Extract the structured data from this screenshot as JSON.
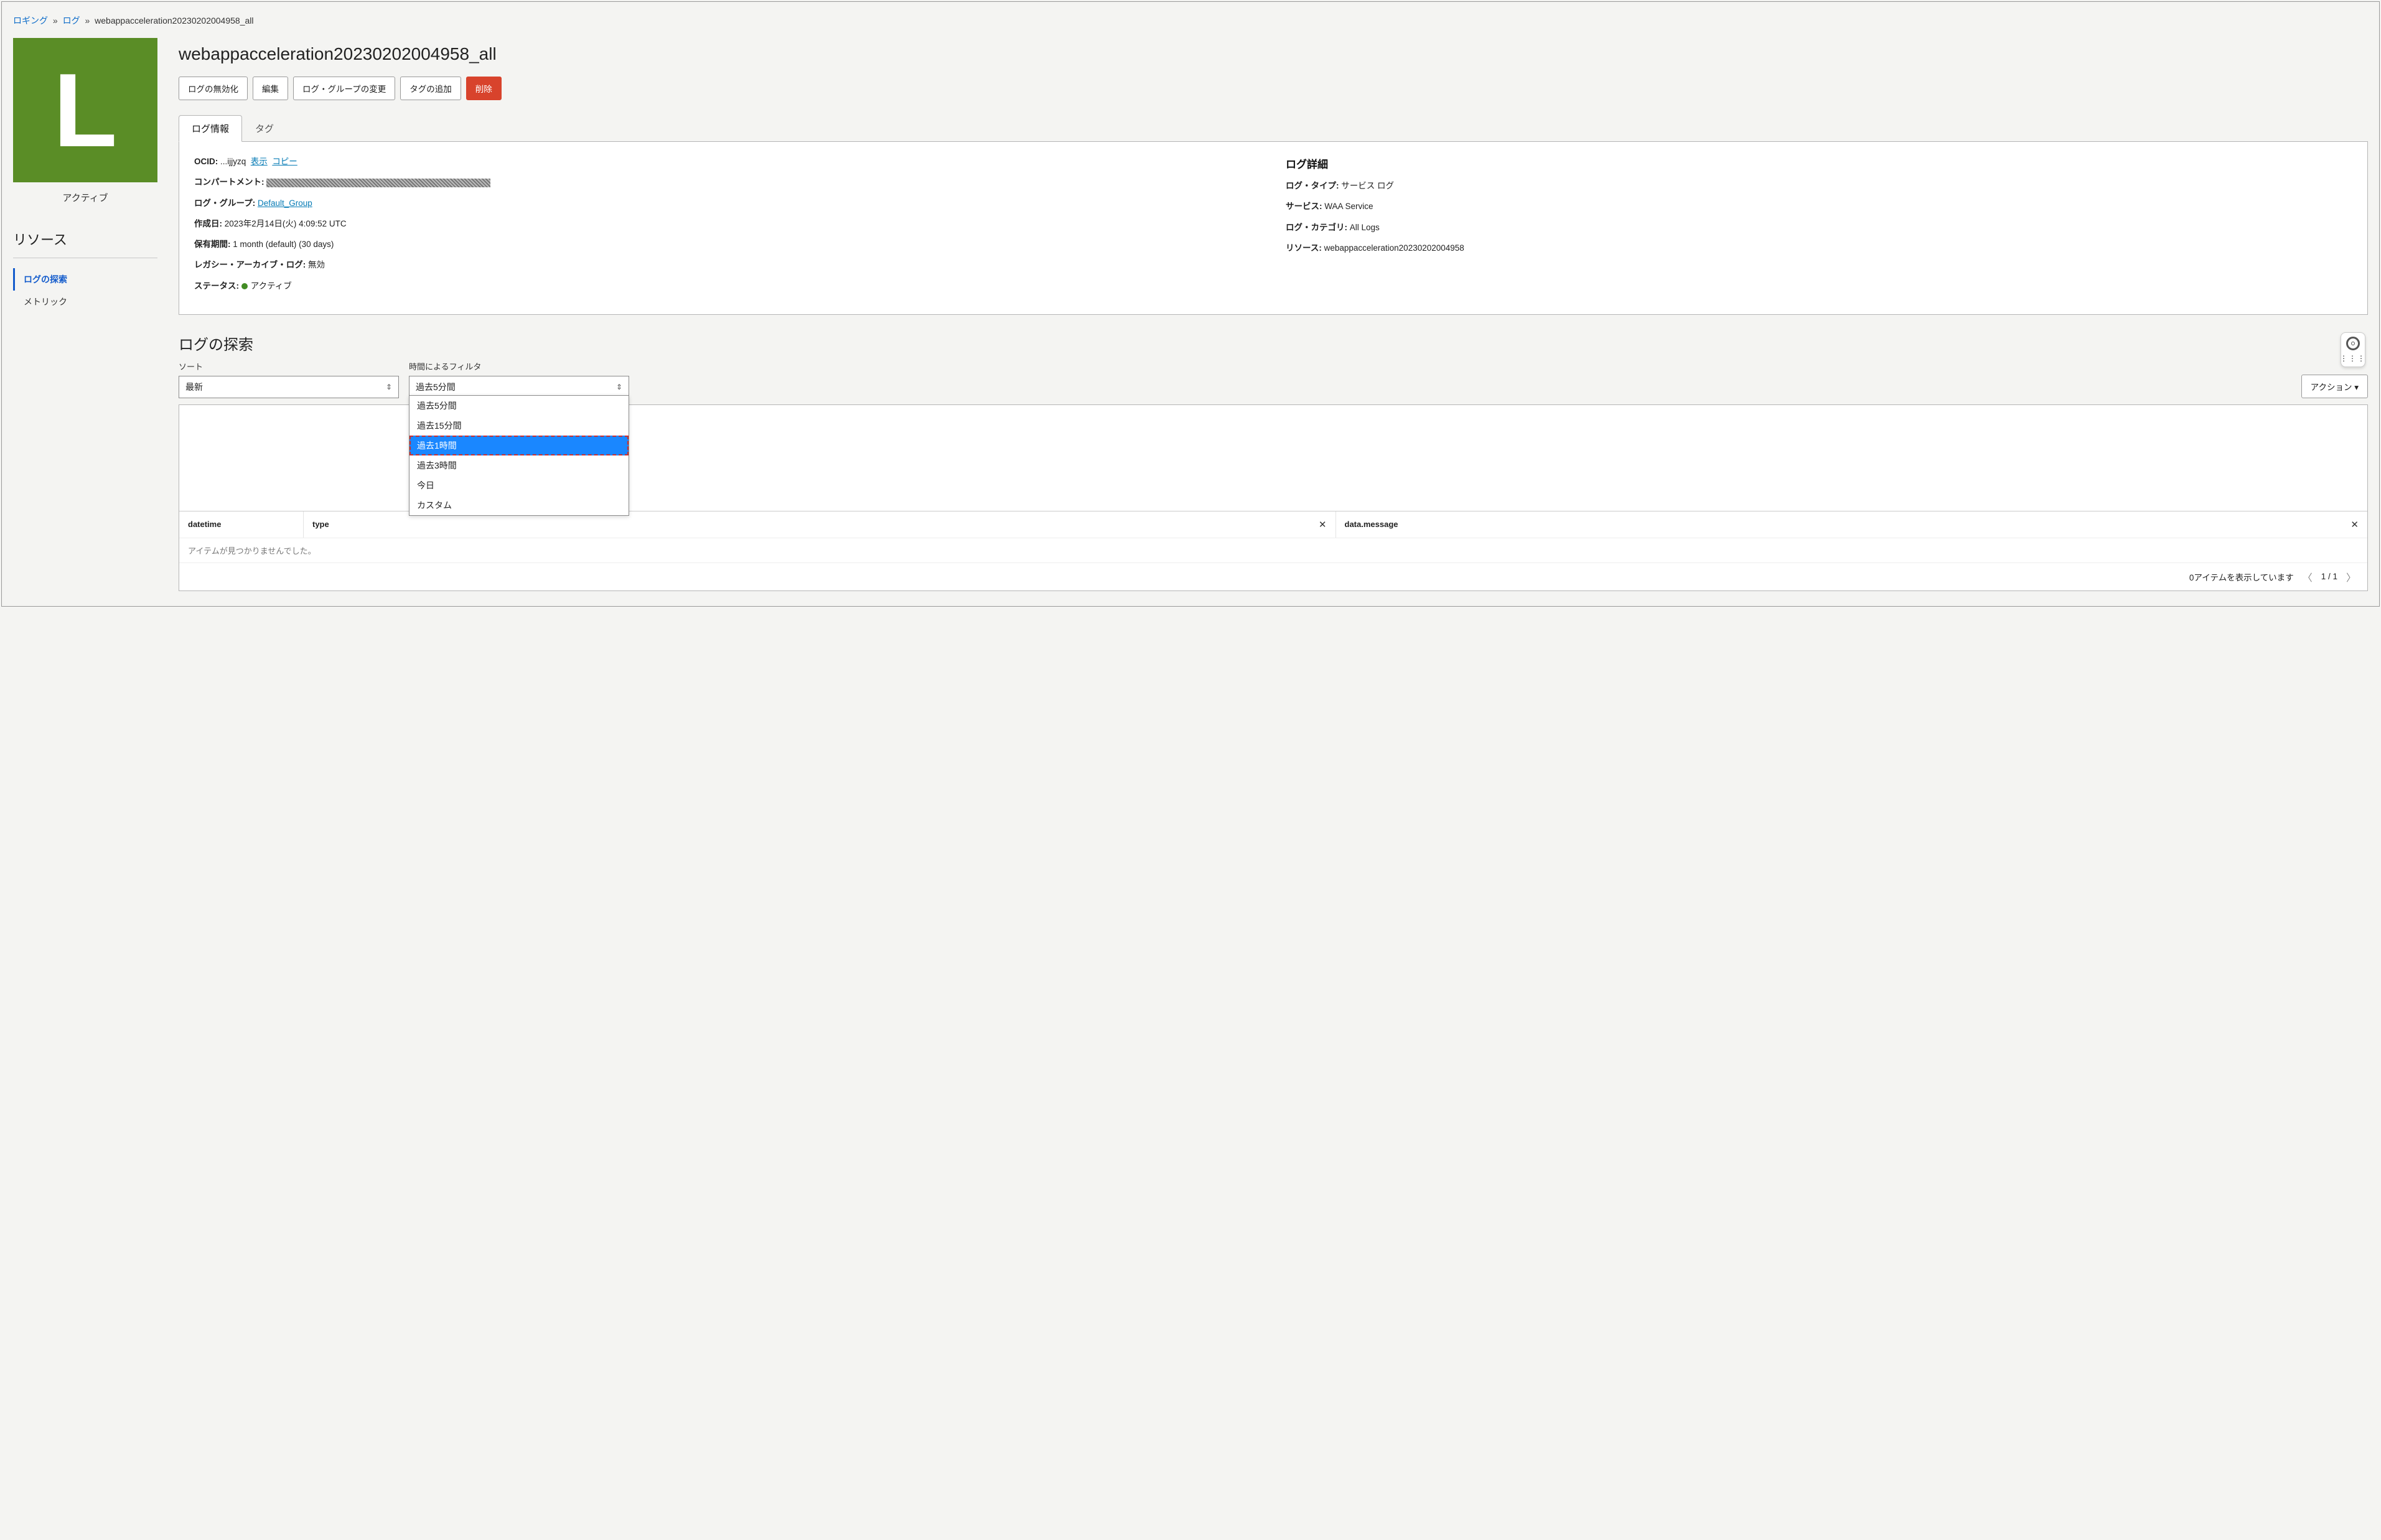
{
  "breadcrumb": {
    "root": "ロギング",
    "mid": "ログ",
    "current": "webappacceleration20230202004958_all"
  },
  "status_label": "アクティブ",
  "icon_letter": "L",
  "sidebar": {
    "header": "リソース",
    "items": [
      {
        "label": "ログの探索",
        "active": true
      },
      {
        "label": "メトリック",
        "active": false
      }
    ]
  },
  "page_title": "webappacceleration20230202004958_all",
  "buttons": {
    "disable": "ログの無効化",
    "edit": "編集",
    "change_group": "ログ・グループの変更",
    "add_tag": "タグの追加",
    "delete": "削除"
  },
  "tabs": [
    {
      "label": "ログ情報",
      "active": true
    },
    {
      "label": "タグ",
      "active": false
    }
  ],
  "info_left": {
    "ocid_label": "OCID:",
    "ocid_val": "...ijjyzq",
    "ocid_show": "表示",
    "ocid_copy": "コピー",
    "compartment_label": "コンパートメント:",
    "loggroup_label": "ログ・グループ:",
    "loggroup_val": "Default_Group",
    "created_label": "作成日:",
    "created_val": "2023年2月14日(火) 4:09:52 UTC",
    "retention_label": "保有期間:",
    "retention_val": "1 month (default) (30 days)",
    "legacy_label": "レガシー・アーカイブ・ログ:",
    "legacy_val": "無効",
    "status_label_k": "ステータス:",
    "status_val": "アクティブ"
  },
  "info_right": {
    "header": "ログ詳細",
    "logtype_label": "ログ・タイプ:",
    "logtype_val": "サービス ログ",
    "service_label": "サービス:",
    "service_val": "WAA Service",
    "category_label": "ログ・カテゴリ:",
    "category_val": "All Logs",
    "resource_label": "リソース:",
    "resource_val": "webappacceleration20230202004958"
  },
  "explore": {
    "title": "ログの探索",
    "sort_label": "ソート",
    "sort_value": "最新",
    "time_label": "時間によるフィルタ",
    "time_value": "過去5分間",
    "actions": "アクション",
    "dropdown": [
      "過去5分間",
      "過去15分間",
      "過去1時間",
      "過去3時間",
      "今日",
      "カスタム"
    ],
    "dropdown_selected_index": 2,
    "table": {
      "col1": "datetime",
      "col2": "type",
      "col3": "data.message",
      "empty": "アイテムが見つかりませんでした。",
      "pager_text": "0アイテムを表示しています",
      "pager_page": "1 / 1"
    }
  }
}
